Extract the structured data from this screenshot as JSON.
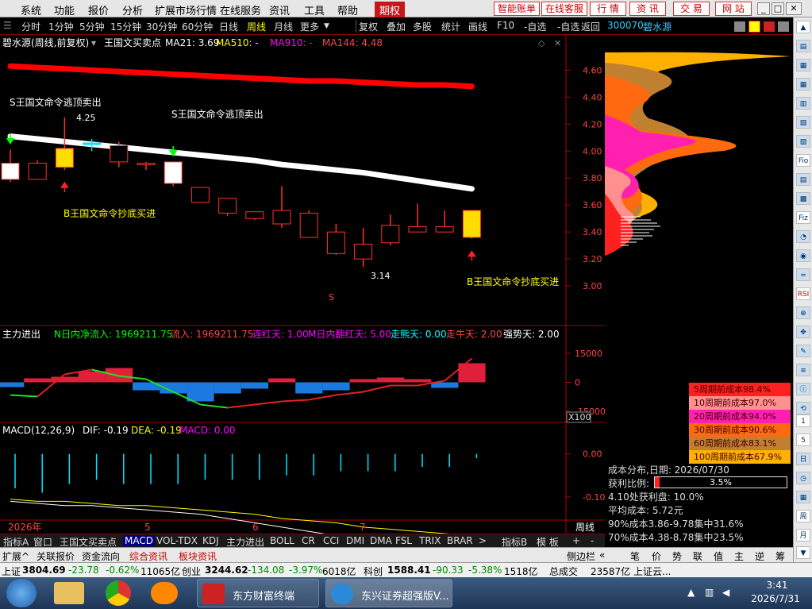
{
  "menu": {
    "items": [
      "系统",
      "功能",
      "报价",
      "分析",
      "扩展市场行情",
      "在线服务",
      "资讯",
      "工具",
      "帮助"
    ],
    "active": "期权",
    "right_buttons": [
      "智能账单",
      "在线客服",
      "行 情",
      "资 讯",
      "交 易",
      "网 站"
    ]
  },
  "toolbar": {
    "periods": [
      "分时",
      "1分钟",
      "5分钟",
      "15分钟",
      "30分钟",
      "60分钟",
      "日线",
      "周线",
      "月线",
      "更多"
    ],
    "selected_period": "周线",
    "actions": [
      "复权",
      "叠加",
      "多股",
      "统计",
      "画线",
      "F10",
      "-自选",
      "返回"
    ]
  },
  "stock": {
    "code": "300070",
    "name": "碧水源"
  },
  "main_chart": {
    "title": "碧水源(周线,前复权)",
    "indicator": "王国文买卖点",
    "ma21_label": "MA21: 3.69",
    "ma510_label": "MA510: -",
    "ma910_label": "MA910: -",
    "ma144_label": "MA144: 4.48",
    "annotation_sell_1": "S王国文命令逃顶卖出",
    "annotation_sell_2": "S王国文命令逃顶卖出",
    "annotation_buy_1": "B王国文命令抄底买进",
    "annotation_buy_2": "B王国文命令抄底买进",
    "high_label": "4.25",
    "low_label": "3.14",
    "price_ticks": [
      "4.60",
      "4.40",
      "4.20",
      "4.00",
      "3.80",
      "3.60",
      "3.40",
      "3.20",
      "3.00"
    ],
    "marker_s": "S"
  },
  "chart_data": {
    "type": "candlestick",
    "title": "碧水源(周线,前复权)",
    "ylim": [
      2.93,
      4.72
    ],
    "candles": [
      {
        "o": 3.79,
        "h": 4.01,
        "l": 3.77,
        "c": 3.91
      },
      {
        "o": 3.79,
        "h": 3.93,
        "l": 3.79,
        "c": 3.91
      },
      {
        "o": 3.88,
        "h": 4.25,
        "l": 3.86,
        "c": 4.02
      },
      {
        "o": 4.06,
        "h": 4.09,
        "l": 4.0,
        "c": 4.05
      },
      {
        "o": 3.92,
        "h": 4.07,
        "l": 3.88,
        "c": 4.04
      },
      {
        "o": 3.91,
        "h": 3.92,
        "l": 3.86,
        "c": 3.91
      },
      {
        "o": 3.76,
        "h": 3.92,
        "l": 3.74,
        "c": 3.92
      },
      {
        "o": 3.62,
        "h": 3.73,
        "l": 3.62,
        "c": 3.73
      },
      {
        "o": 3.54,
        "h": 3.65,
        "l": 3.52,
        "c": 3.65
      },
      {
        "o": 3.5,
        "h": 3.55,
        "l": 3.49,
        "c": 3.55
      },
      {
        "o": 3.46,
        "h": 3.74,
        "l": 3.43,
        "c": 3.56
      },
      {
        "o": 3.36,
        "h": 3.56,
        "l": 3.36,
        "c": 3.54
      },
      {
        "o": 3.24,
        "h": 3.46,
        "l": 3.23,
        "c": 3.4
      },
      {
        "o": 3.2,
        "h": 3.43,
        "l": 3.14,
        "c": 3.31
      },
      {
        "o": 3.32,
        "h": 3.53,
        "l": 3.3,
        "c": 3.45
      },
      {
        "o": 3.4,
        "h": 3.61,
        "l": 3.4,
        "c": 3.44
      },
      {
        "o": 3.4,
        "h": 3.56,
        "l": 3.4,
        "c": 3.44
      },
      {
        "o": 3.36,
        "h": 3.56,
        "l": 3.35,
        "c": 3.56
      }
    ],
    "ma21": [
      4.11,
      4.09,
      4.07,
      4.05,
      4.03,
      4.01,
      3.99,
      3.97,
      3.95,
      3.93,
      3.9,
      3.88,
      3.86,
      3.84,
      3.81,
      3.78,
      3.75,
      3.72
    ],
    "ma144": [
      4.63,
      4.62,
      4.61,
      4.6,
      4.59,
      4.58,
      4.57,
      4.56,
      4.55,
      4.54,
      4.53,
      4.52,
      4.52,
      4.51,
      4.5,
      4.49,
      4.49,
      4.48
    ],
    "buy_signals": [
      2,
      17
    ],
    "sell_signals": [
      0,
      6
    ]
  },
  "flow_panel": {
    "title": "主力进出",
    "label_n": "N日内净流入: 1969211.75",
    "label_in": "流入: 1969211.75",
    "label_red": "连红天: 1.00",
    "label_m": "M日内翻红天: 5.00",
    "label_bear": "走熊天: 0.00",
    "label_bull": "走牛天: 2.00",
    "label_strong": "强势天: 2.00",
    "ticks": [
      "15000",
      "0",
      "-15000"
    ],
    "scale": "X100",
    "ylim": [
      -20000,
      20000
    ],
    "bars": [
      -0.3,
      0.25,
      0.35,
      0.7,
      0.9,
      -0.5,
      -0.7,
      -1.2,
      -0.7,
      -0.4,
      0.25,
      -0.7,
      -0.5,
      0.2,
      0.3,
      0.2,
      -0.35,
      1.2
    ],
    "line": [
      -0.8,
      -0.9,
      0.5,
      0.8,
      0.4,
      0.2,
      -0.6,
      -1.4,
      -1.6,
      -1.4,
      -1.2,
      -1.1,
      -0.8,
      -0.6,
      -0.2,
      -0.2,
      0.1,
      1.5
    ]
  },
  "macd_panel": {
    "title": "MACD(12,26,9)",
    "dif": "DIF: -0.19",
    "dea": "DEA: -0.19",
    "macd": "MACD: 0.00",
    "ticks": [
      "0.00",
      "-0.10"
    ],
    "ylim": [
      -0.15,
      0.04
    ],
    "hist": [
      -0.08,
      -0.09,
      -0.07,
      -0.06,
      -0.07,
      -0.07,
      -0.07,
      -0.06,
      -0.06,
      -0.06,
      -0.05,
      -0.05,
      -0.04,
      -0.04,
      -0.04,
      -0.03,
      -0.03,
      -0.01
    ],
    "dif_line": [
      -0.11,
      -0.115,
      -0.12,
      -0.12,
      -0.125,
      -0.13,
      -0.135,
      -0.14,
      -0.15,
      -0.16,
      -0.17,
      -0.18,
      -0.19,
      -0.2,
      -0.2,
      -0.2,
      -0.2,
      -0.19
    ],
    "dea_line": [
      -0.105,
      -0.11,
      -0.11,
      -0.115,
      -0.12,
      -0.12,
      -0.125,
      -0.13,
      -0.135,
      -0.14,
      -0.15,
      -0.155,
      -0.16,
      -0.17,
      -0.175,
      -0.18,
      -0.185,
      -0.19
    ]
  },
  "time_axis": {
    "year": "2026年",
    "m5": "5",
    "m6": "6",
    "m7": "7",
    "period": "周线"
  },
  "tabs_row1": [
    "指标A",
    "窗口",
    "王国文买卖点",
    "MACD",
    "VOL-TDX",
    "KDJ",
    "主力进出",
    "BOLL",
    "CR",
    "CCI",
    "DMI",
    "DMA",
    "FSL",
    "TRIX",
    "BRAR",
    ">",
    "指标B",
    "模 板",
    "+",
    "-"
  ],
  "tabs_row1_selected": "MACD",
  "tabs_row2": [
    "扩展^",
    "关联报价",
    "资金流向",
    "综合资讯",
    "板块资讯"
  ],
  "sidebar_label": "侧边栏",
  "sidebar_chars": [
    "笔",
    "价",
    "势",
    "联",
    "值",
    "主",
    "逆",
    "筹"
  ],
  "cost_panel": {
    "code": "300070",
    "name": "碧水源",
    "legend": [
      {
        "text": "5周期前成本98.4%",
        "bg": "#ff2020"
      },
      {
        "text": "10周期前成本97.0%",
        "bg": "#ff9090"
      },
      {
        "text": "20周期前成本94.0%",
        "bg": "#ff20b0"
      },
      {
        "text": "30周期前成本90.6%",
        "bg": "#ff6a10"
      },
      {
        "text": "60周期前成本83.1%",
        "bg": "#c08030"
      },
      {
        "text": "100周期前成本67.9%",
        "bg": "#ffb000"
      }
    ],
    "date_line": "成本分布,日期:  2026/07/30",
    "profit_label": "获利比例:",
    "profit_value": "3.5%",
    "profit_ratio": 0.035,
    "pl_line": "4.10处获利盘:  10.0%",
    "avg_line": "平均成本:  5.72元",
    "c90": "90%成本3.86-9.78集中31.6%",
    "c70": "70%成本4.38-8.78集中23.5%"
  },
  "status_bar": {
    "sh_label": "上证",
    "sh_value": "3804.69",
    "sh_change": "-23.78",
    "sh_pct": "-0.62%",
    "sh_vol": "11065亿",
    "cy_label": "创业",
    "cy_value": "3244.62",
    "cy_change": "-134.08",
    "cy_pct": "-3.97%",
    "cy_vol": "6018亿",
    "kc_label": "科创",
    "kc_value": "1588.41",
    "kc_change": "-90.33",
    "kc_pct": "-5.38%",
    "kc_vol": "1518亿",
    "total_label": "总成交",
    "total_value": "23587亿",
    "news": "上证云..."
  },
  "taskbar": {
    "app1": "东方财富终端",
    "app2": "东兴证券超强版V...",
    "time": "3:41",
    "date": "2026/7/31"
  },
  "right_icons": [
    "1",
    "5",
    "RSI",
    "Fio",
    "Fiz"
  ]
}
